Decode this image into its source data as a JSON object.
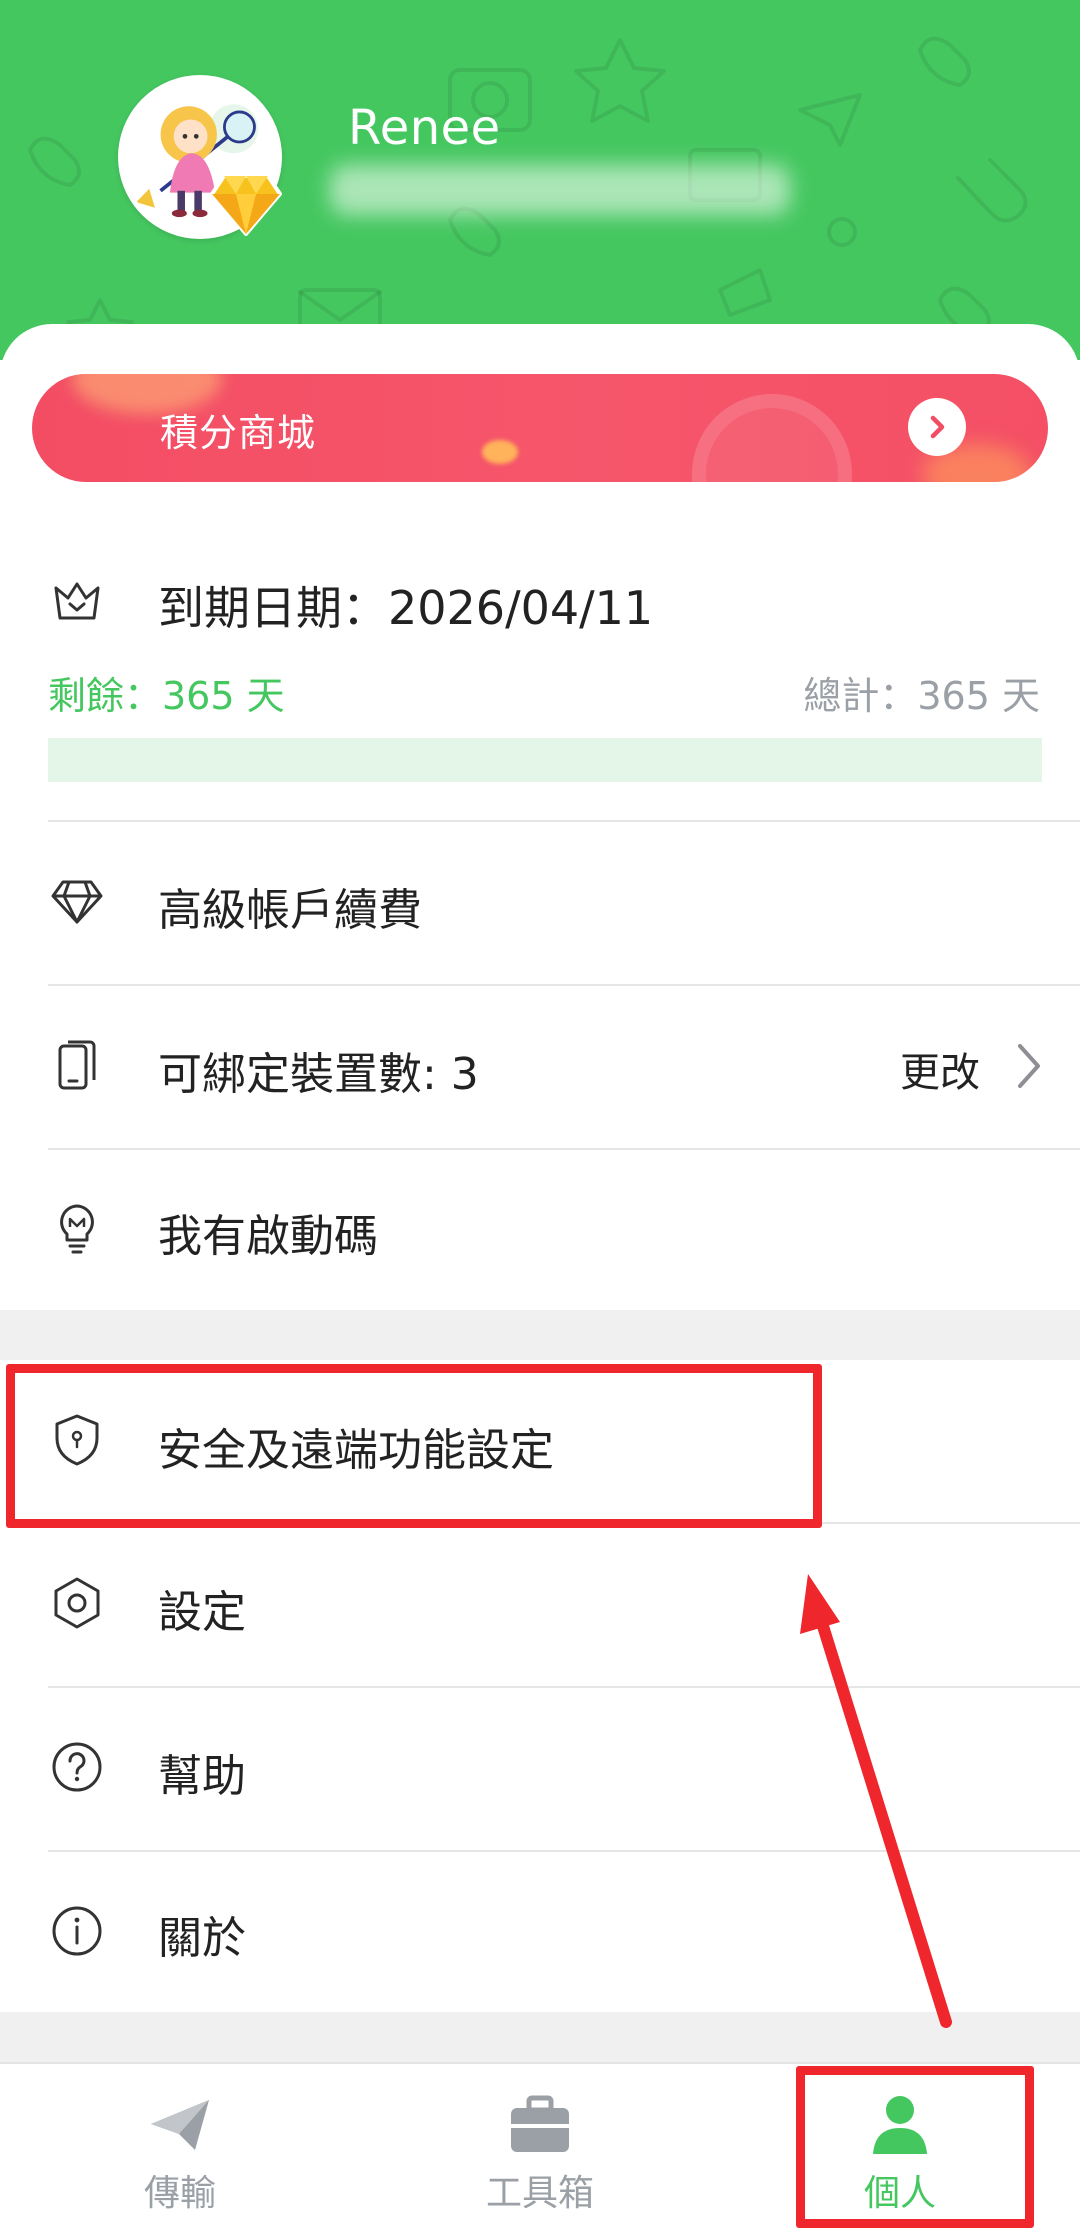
{
  "profile": {
    "username": "Renee"
  },
  "points_mall": {
    "label": "積分商城"
  },
  "membership": {
    "expiry_label": "到期日期：2026/04/11",
    "remaining_label": "剩餘：365 天",
    "total_label": "總計：365 天",
    "remaining_days": 365,
    "total_days": 365
  },
  "menu": {
    "renew": {
      "label": "高級帳戶續費",
      "icon": "diamond-icon"
    },
    "devices": {
      "label": "可綁定裝置數: 3",
      "action": "更改",
      "icon": "phone-icon"
    },
    "activation": {
      "label": "我有啟動碼",
      "icon": "bulb-icon"
    },
    "security": {
      "label": "安全及遠端功能設定",
      "icon": "shield-icon"
    },
    "settings": {
      "label": "設定",
      "icon": "hexagon-gear-icon"
    },
    "help": {
      "label": "幫助",
      "icon": "question-icon"
    },
    "about": {
      "label": "關於",
      "icon": "info-icon"
    }
  },
  "bottom_nav": {
    "items": [
      {
        "label": "傳輸",
        "icon": "paper-plane-icon",
        "active": false
      },
      {
        "label": "工具箱",
        "icon": "toolbox-icon",
        "active": false
      },
      {
        "label": "個人",
        "icon": "person-icon",
        "active": true
      }
    ]
  },
  "colors": {
    "brand_green": "#45c760",
    "banner_red": "#f34d64",
    "annotation_red": "#f0262d"
  }
}
